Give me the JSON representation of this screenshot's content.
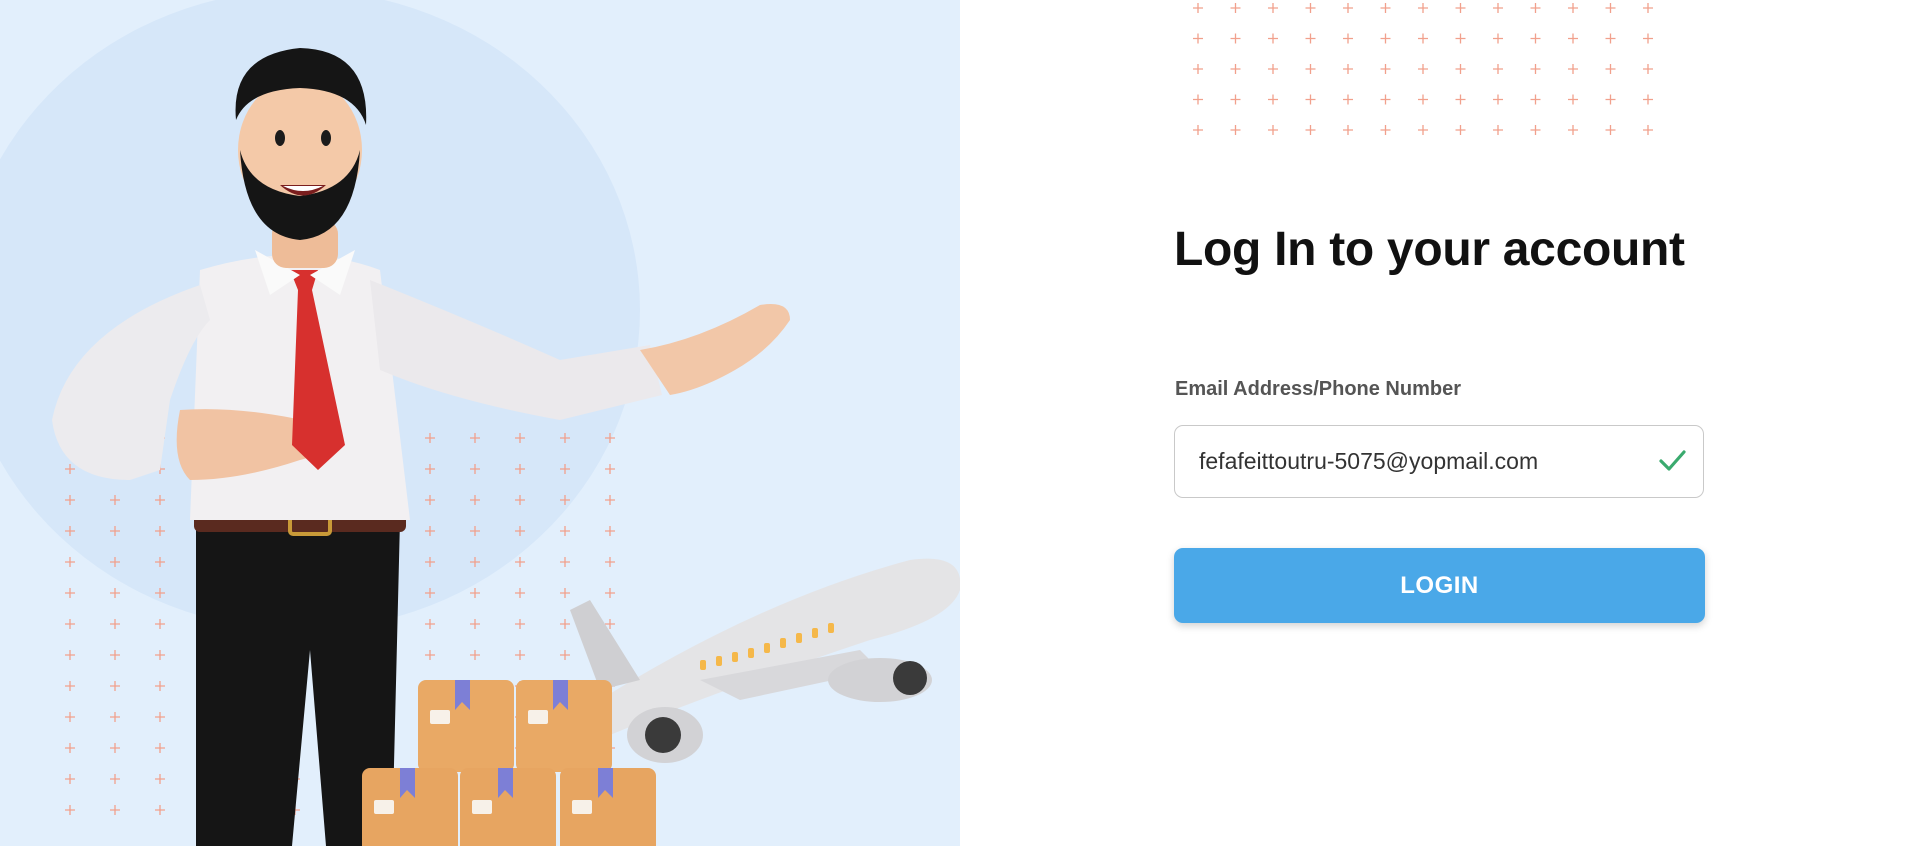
{
  "hero": {
    "illustration": "businessman-presenting-with-parcels-and-airplane",
    "icons": [
      "plus-pattern-icon"
    ]
  },
  "login_form": {
    "title": "Log In to your account",
    "email_label": "Email Address/Phone Number",
    "email_value": "fefafeittoutru-5075@yopmail.com",
    "email_valid_icon": "checkmark-icon",
    "submit_label": "LOGIN"
  },
  "colors": {
    "hero_background": "#e2effc",
    "accent": "#4aa8e8",
    "valid": "#3aaa6e",
    "decor_plus": "#f1a08c"
  }
}
